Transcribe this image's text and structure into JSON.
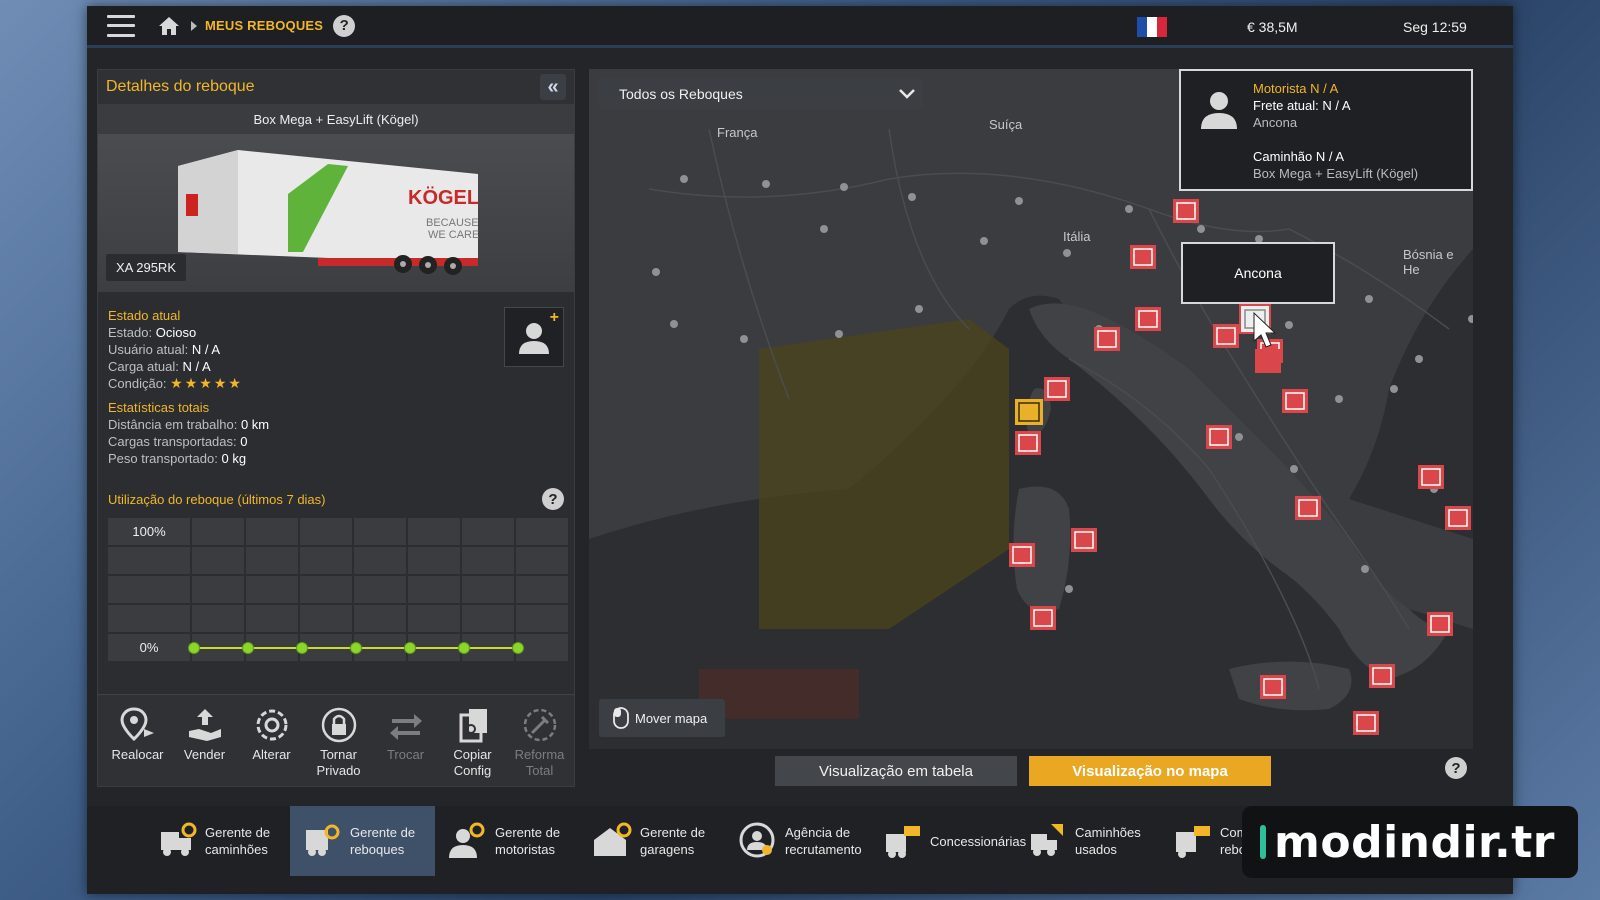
{
  "topbar": {
    "breadcrumb": "MEUS REBOQUES",
    "help": "?",
    "money": "€ 38,5M",
    "clock": "Seg 12:59",
    "flag_colors": [
      "#1f4ea8",
      "#ffffff",
      "#d8263a"
    ]
  },
  "details": {
    "title": "Detalhes do reboque",
    "collapse_icon": "double-chevron-left",
    "trailer_name": "Box Mega + EasyLift (Kögel)",
    "plate": "XA 295RK",
    "current_state_title": "Estado atual",
    "state_label": "Estado:",
    "state_value": "Ocioso",
    "user_label": "Usuário atual:",
    "user_value": "N / A",
    "cargo_label": "Carga atual:",
    "cargo_value": "N / A",
    "condition_label": "Condição:",
    "condition_stars": "★★★★★",
    "condition_rating": 5,
    "stats_title": "Estatísticas totais",
    "distance_label": "Distância em trabalho:",
    "distance_value": "0 km",
    "loads_label": "Cargas transportadas:",
    "loads_value": "0",
    "weight_label": "Peso transportado:",
    "weight_value": "0 kg"
  },
  "utilization": {
    "title": "Utilização do reboque (últimos 7 dias)",
    "top_label": "100%",
    "bottom_label": "0%",
    "values": [
      0,
      0,
      0,
      0,
      0,
      0,
      0
    ],
    "line_color": "#c7dc2d"
  },
  "actions": [
    {
      "label": "Realocar",
      "icon": "relocate-icon",
      "enabled": true
    },
    {
      "label": "Vender",
      "icon": "sell-icon",
      "enabled": true
    },
    {
      "label": "Alterar",
      "icon": "modify-icon",
      "enabled": true
    },
    {
      "label": "Tornar Privado",
      "icon": "lock-icon",
      "enabled": true
    },
    {
      "label": "Trocar",
      "icon": "swap-icon",
      "enabled": false
    },
    {
      "label": "Copiar Config",
      "icon": "copy-config-icon",
      "enabled": true
    },
    {
      "label": "Reforma Total",
      "icon": "overhaul-icon",
      "enabled": false
    }
  ],
  "map": {
    "filter": "Todos os Reboques",
    "labels": {
      "franca": "França",
      "suica": "Suíça",
      "italia": "Itália",
      "bosnia": "Bósnia e He"
    },
    "info_card": {
      "driver": "Motorista N / A",
      "freight": "Frete atual: N / A",
      "city": "Ancona",
      "truck": "Caminhão N / A",
      "trailer": "Box Mega + EasyLift (Kögel)"
    },
    "tooltip_city": "Ancona",
    "move_map": "Mover mapa"
  },
  "view_buttons": {
    "table": "Visualização em tabela",
    "map": "Visualização no mapa"
  },
  "bottom_nav": [
    {
      "label": "Gerente de caminhões",
      "icon": "truck-manager-icon",
      "active": false
    },
    {
      "label": "Gerente de reboques",
      "icon": "trailer-manager-icon",
      "active": true
    },
    {
      "label": "Gerente de motoristas",
      "icon": "driver-manager-icon",
      "active": false
    },
    {
      "label": "Gerente de garagens",
      "icon": "garage-manager-icon",
      "active": false
    },
    {
      "label": "Agência de recrutamento",
      "icon": "recruitment-icon",
      "active": false
    },
    {
      "label": "Concessionárias",
      "icon": "dealer-icon",
      "active": false
    },
    {
      "label": "Caminhões usados",
      "icon": "used-trucks-icon",
      "active": false
    },
    {
      "label": "Compra de reboques",
      "icon": "buy-trailer-icon",
      "active": false
    }
  ],
  "watermark": "modindir.tr",
  "colors": {
    "accent": "#f2b728",
    "active_tab": "#3f5069",
    "marker_red": "#d9474a",
    "marker_yellow": "#e9b12a"
  }
}
